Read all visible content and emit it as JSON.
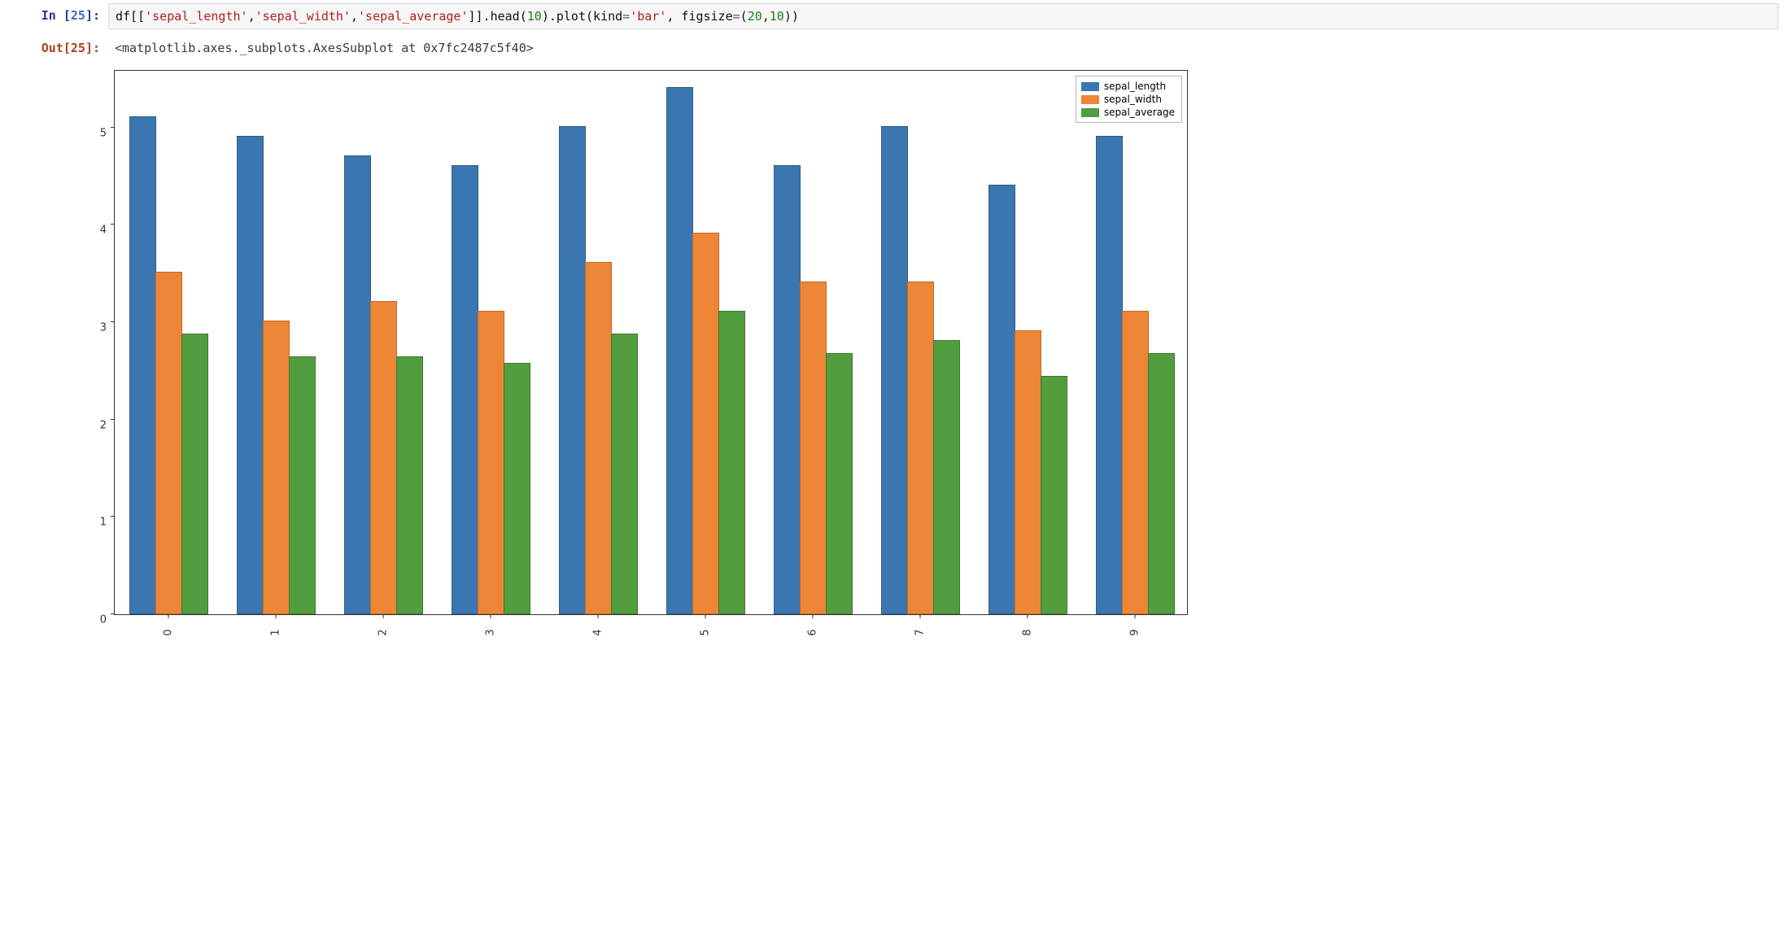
{
  "input_cell": {
    "prompt_prefix": "In [",
    "prompt_number": "25",
    "prompt_suffix": "]:",
    "code_tokens": {
      "t0": "df[[",
      "t1": "'sepal_length'",
      "t2": ",",
      "t3": "'sepal_width'",
      "t4": ",",
      "t5": "'sepal_average'",
      "t6": "]].head(",
      "t7": "10",
      "t8": ").plot(kind",
      "t9": "=",
      "t10": "'bar'",
      "t11": ", figsize",
      "t12": "=",
      "t13": "(",
      "t14": "20",
      "t15": ",",
      "t16": "10",
      "t17": "))"
    }
  },
  "output_cell": {
    "prompt_prefix": "Out[",
    "prompt_number": "25",
    "prompt_suffix": "]:",
    "text": "<matplotlib.axes._subplots.AxesSubplot at 0x7fc2487c5f40>"
  },
  "chart_data": {
    "type": "bar",
    "categories": [
      "0",
      "1",
      "2",
      "3",
      "4",
      "5",
      "6",
      "7",
      "8",
      "9"
    ],
    "series": [
      {
        "name": "sepal_length",
        "color": "#3a76af",
        "values": [
          5.1,
          4.9,
          4.7,
          4.6,
          5.0,
          5.4,
          4.6,
          5.0,
          4.4,
          4.9
        ]
      },
      {
        "name": "sepal_width",
        "color": "#ed8636",
        "values": [
          3.5,
          3.0,
          3.2,
          3.1,
          3.6,
          3.9,
          3.4,
          3.4,
          2.9,
          3.1
        ]
      },
      {
        "name": "sepal_average",
        "color": "#529d3e",
        "values": [
          2.87,
          2.63,
          2.63,
          2.57,
          2.87,
          3.1,
          2.67,
          2.8,
          2.43,
          2.67
        ]
      }
    ],
    "y_ticks": [
      0,
      1,
      2,
      3,
      4,
      5
    ],
    "ylim": [
      0,
      5.6
    ],
    "xlabel": "",
    "ylabel": "",
    "title": "",
    "legend_position": "upper right"
  },
  "legend": {
    "items": [
      {
        "label": "sepal_length"
      },
      {
        "label": "sepal_width"
      },
      {
        "label": "sepal_average"
      }
    ]
  }
}
